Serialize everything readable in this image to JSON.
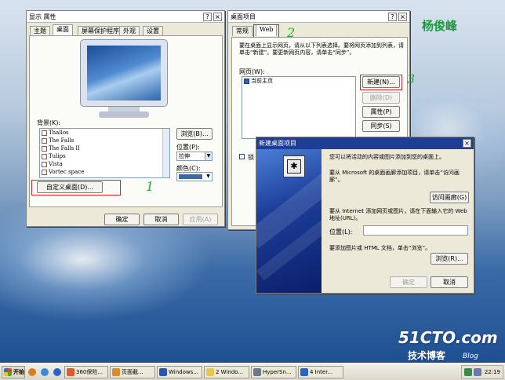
{
  "watermark_name": "杨俊峰",
  "annotations": {
    "one": "1",
    "two": "2",
    "three": "3"
  },
  "brand": {
    "site": "51CTO.com",
    "tagline": "技术博客",
    "blog": "Blog"
  },
  "display_props": {
    "title": "显示 属性",
    "tabs": [
      "主题",
      "桌面",
      "屏幕保护程序",
      "外观",
      "设置"
    ],
    "background_label": "背景(K):",
    "backgrounds": [
      "Thallos",
      "The Falls",
      "The Falls II",
      "Tulips",
      "Vista",
      "Vortec space"
    ],
    "browse_label": "浏览(B)...",
    "position_label": "位置(P):",
    "position_value": "拉伸",
    "color_label": "颜色(C):",
    "customize_label": "自定义桌面(D)...",
    "ok": "确定",
    "cancel": "取消",
    "apply": "应用(A)"
  },
  "desktop_items": {
    "title": "桌面项目",
    "tabs": [
      "常规",
      "Web"
    ],
    "desc": "要在桌面上显示网页，请从以下列表选择。要将网页添加到列表，请单击“新建”。要更新网页内容，请单击“同步”。",
    "webpages_label": "网页(W):",
    "webpage_item": "当前主页",
    "new_label": "新建(N)...",
    "delete_label": "删除(D)",
    "properties_label": "属性(P)",
    "sync_label": "同步(S)",
    "lock_label": "锁"
  },
  "new_item": {
    "title": "新建桌面项目",
    "intro": "您可以将活动的内容或图片添加到您的桌面上。",
    "gallery_text": "要从 Microsoft 的桌面画廊添加项目，请单击“访问画廊”。",
    "visit_gallery": "访问画廊(G)",
    "internet_text": "要从 Internet 添加网页或图片，请在下面输入它的 Web 地址(URL)。",
    "location_label": "位置(L):",
    "location_value": "",
    "html_text": "要添加图片或 HTML 文档，单击“浏览”。",
    "browse_label": "浏览(R)...",
    "ok": "确定",
    "cancel": "取消"
  },
  "taskbar": {
    "start": "开始",
    "items": [
      "360保险...",
      "页面截...",
      "Windows...",
      "2 Windo...",
      "HyperSn...",
      "4 Inter..."
    ],
    "clock": "22:19"
  },
  "colors": {
    "accent_red": "#e02020",
    "annotation_green": "#22aa33",
    "title_green": "#1c9a3c"
  }
}
